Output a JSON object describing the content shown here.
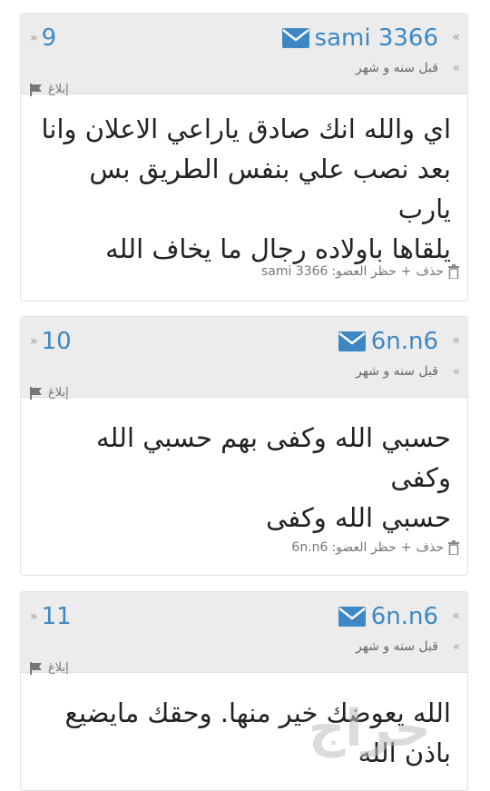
{
  "posts": [
    {
      "number": "9",
      "author": "sami 3366",
      "time": "قبل سنه و شهر",
      "report_label": "إبلاغ",
      "content_lines": [
        "اي والله انك صادق ياراعي الاعلان وانا",
        "بعد نصب علي بنفس الطريق بس يارب",
        "يلقاها باولاده رجال ما يخاف الله"
      ],
      "delete_label": "حذف",
      "ban_label": "حظر العضو:",
      "ban_user": "sami 3366"
    },
    {
      "number": "10",
      "author": "6n.n6",
      "time": "قبل سنه و شهر",
      "report_label": "إبلاغ",
      "content_lines": [
        "حسبي الله وكفى بهم حسبي الله وكفى",
        "حسبي الله وكفى"
      ],
      "delete_label": "حذف",
      "ban_label": "حظر العضو:",
      "ban_user": "6n.n6"
    },
    {
      "number": "11",
      "author": "6n.n6",
      "time": "قبل سنه و شهر",
      "report_label": "إبلاغ",
      "content_lines": [
        "الله يعوضك خير منها. وحقك مايضيع",
        "باذن الله"
      ]
    }
  ],
  "colors": {
    "accent": "#3d88c4",
    "header_bg": "#ececec"
  },
  "icons": {
    "author": "mail-icon",
    "report": "flag-icon",
    "delete": "trash-icon"
  },
  "watermark": "حراج"
}
